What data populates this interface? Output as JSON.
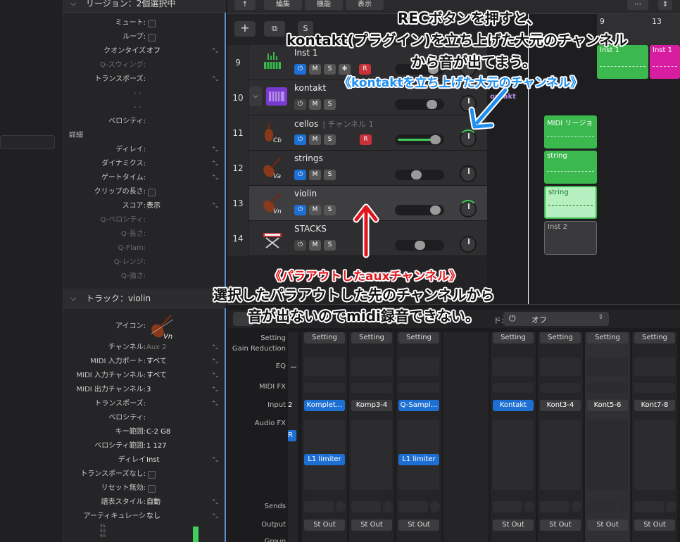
{
  "inspector": {
    "region_header": "リージョン：2個選択中",
    "region_rows": [
      {
        "label": "ミュート:",
        "type": "checkbox"
      },
      {
        "label": "ループ:",
        "type": "checkbox"
      },
      {
        "label": "クオンタイズ",
        "value": "オフ",
        "type": "select"
      },
      {
        "label": "Q-スウィング:",
        "dim": true
      },
      {
        "label": "トランスポーズ:",
        "type": "stepper"
      },
      {
        "label": "",
        "value": "- -",
        "dim": true
      },
      {
        "label": "",
        "value": "- -",
        "dim": true
      },
      {
        "label": "ベロシティ:"
      },
      {
        "label": "詳細",
        "type": "section"
      },
      {
        "label": "ディレイ:",
        "type": "stepper"
      },
      {
        "label": "ダイナミクス:",
        "type": "stepper"
      },
      {
        "label": "ゲートタイム:",
        "type": "stepper"
      },
      {
        "label": "クリップの長さ:",
        "type": "checkbox"
      },
      {
        "label": "スコア:",
        "value": "表示",
        "type": "select"
      },
      {
        "label": "Q-ベロシティ:",
        "dim": true
      },
      {
        "label": "Q-長さ:",
        "dim": true
      },
      {
        "label": "Q-Flam:",
        "dim": true
      },
      {
        "label": "Q-レンジ:",
        "dim": true
      },
      {
        "label": "Q-強さ:",
        "dim": true
      }
    ],
    "track_header": "トラック：violin",
    "icon_label": "アイコン:",
    "track_rows": [
      {
        "label": "チャンネル:",
        "value": "Aux 2",
        "dimval": true,
        "type": "select"
      },
      {
        "label": "MIDI 入力ポート:",
        "value": "すべて",
        "type": "select"
      },
      {
        "label": "MIDI 入力チャンネル:",
        "value": "すべて",
        "type": "select"
      },
      {
        "label": "MIDI 出力チャンネル:",
        "value": "3",
        "type": "select"
      },
      {
        "label": "トランスポーズ:",
        "type": "stepper"
      },
      {
        "label": "ベロシティ:"
      },
      {
        "label": "キー範囲:",
        "value": "C-2  G8"
      },
      {
        "label": "ベロシティ範囲:",
        "value": "1   127"
      },
      {
        "label": "ディレイ",
        "value": "Inst",
        "type": "select"
      },
      {
        "label": "トランスポーズなし:",
        "type": "checkbox"
      },
      {
        "label": "リセット無効:",
        "type": "checkbox"
      },
      {
        "label": "譜表スタイル:",
        "value": "自動",
        "type": "select"
      },
      {
        "label": "アーティキュレーシ",
        "value": "なし",
        "type": "select"
      }
    ]
  },
  "toolbar": {
    "edit": "編集",
    "function": "機能",
    "view": "表示"
  },
  "tracks": [
    {
      "num": "9",
      "name": "Inst 1",
      "sub": "",
      "buttons": [
        "pow",
        "M",
        "S",
        "*",
        "R"
      ],
      "slider": 0.9,
      "child": false,
      "selected": false,
      "icon": "keyboard-icon"
    },
    {
      "num": "10",
      "name": "kontakt",
      "sub": "",
      "buttons": [
        "powoff",
        "M",
        "S"
      ],
      "slider": 0.85,
      "child": false,
      "selected": false,
      "icon": "plugin-icon"
    },
    {
      "num": "11",
      "name": "cellos",
      "sub": "| チャンネル 1",
      "buttons": [
        "pow",
        "M",
        "S",
        "R"
      ],
      "slider": 0.95,
      "child": true,
      "selected": false,
      "icon": "cello-icon",
      "glyph": "Cb",
      "level": true
    },
    {
      "num": "12",
      "name": "strings",
      "sub": "",
      "buttons": [
        "pow",
        "M",
        "S"
      ],
      "slider": 0.4,
      "child": true,
      "selected": false,
      "icon": "violin-icon",
      "glyph": "Va"
    },
    {
      "num": "13",
      "name": "violin",
      "sub": "",
      "buttons": [
        "pow",
        "M",
        "S"
      ],
      "slider": 0.95,
      "child": true,
      "selected": true,
      "icon": "violin-icon",
      "glyph": "Vn"
    },
    {
      "num": "14",
      "name": "STACKS",
      "sub": "",
      "buttons": [
        "powoff",
        "M",
        "S"
      ],
      "slider": 0.5,
      "child": true,
      "selected": false,
      "icon": "keyboard-stand-icon"
    }
  ],
  "ruler": {
    "bar9": "9",
    "bar13": "13"
  },
  "regions": {
    "inst1_a": "Inst 1",
    "inst1_b": "Inst 1",
    "kontakt": "ontakt",
    "midi": "MIDI リージョ",
    "string1": "string",
    "string2": "string",
    "inst2": "Inst 2"
  },
  "mixer": {
    "dropdown_label": "ド:",
    "dropdown_value": "オフ",
    "row_labels": [
      "Setting",
      "Gain Reduction",
      "EQ",
      "MIDI FX",
      "Input",
      "Audio FX",
      "Sends",
      "Output",
      "Group"
    ],
    "setting": "Setting",
    "strips": [
      {
        "input": "2",
        "inputStyle": "partial"
      },
      {
        "input": "Komplet...",
        "inputStyle": "blue",
        "fx": "L1 limiter"
      },
      {
        "input": "Komp3-4",
        "inputStyle": "gray"
      },
      {
        "input": "Q-Sampl...",
        "inputStyle": "blue",
        "fx": "L1 limiter"
      },
      {
        "input": "",
        "inputStyle": "none"
      },
      {
        "input": "Kontakt",
        "inputStyle": "blue"
      },
      {
        "input": "Kont3-4",
        "inputStyle": "gray"
      },
      {
        "input": "Kont5-6",
        "inputStyle": "gray",
        "highlight": true
      },
      {
        "input": "Kont7-8",
        "inputStyle": "gray"
      }
    ],
    "output": "St Out"
  },
  "annotations": {
    "rec_line1": "RECボタンを押すと、",
    "rec_line2": "kontakt(プラグイン)を立ち上げた大元のチャンネル",
    "rec_line3": "から音が出てまう。",
    "kontakt_channel": "《kontaktを立ち上げた大元のチャンネル》",
    "aux_channel": "《パラアウトしたauxチャンネル》",
    "aux_line1": "選択したパラアウトした先のチャンネルから",
    "aux_line2": "音が出ないのでmidi録音できない。"
  },
  "colors": {
    "accent": "#1d6fd3",
    "region_green": "#3bb84e",
    "region_pink": "#d81ea0",
    "record": "#c8313a",
    "note_red": "#e0161e",
    "note_blue": "#1e8ff0"
  }
}
